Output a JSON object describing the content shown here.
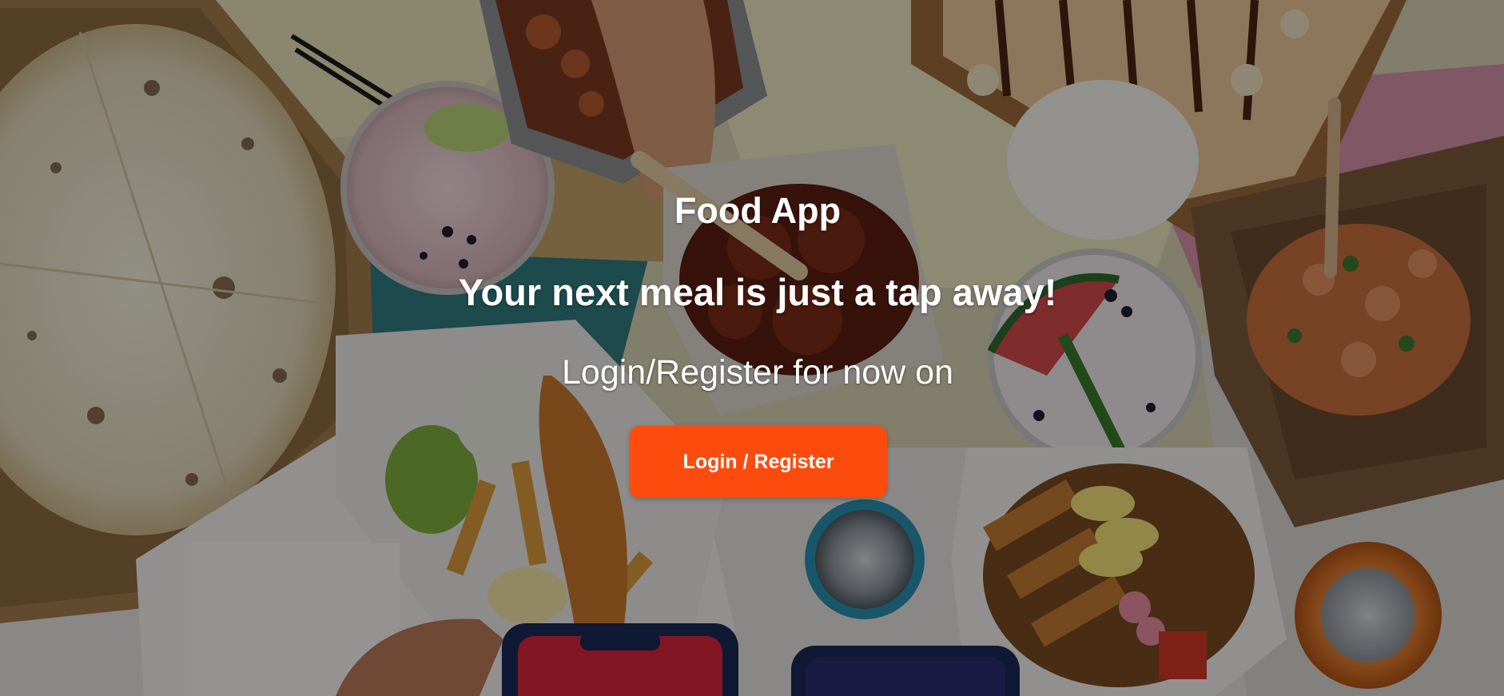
{
  "app": {
    "title": "Food App",
    "tagline": "Your next meal is just a tap away!",
    "subtext": "Login/Register for now on"
  },
  "cta": {
    "label": "Login / Register",
    "color": "#fb4c0e"
  },
  "background": {
    "description_icon": "food-spread-photo"
  }
}
